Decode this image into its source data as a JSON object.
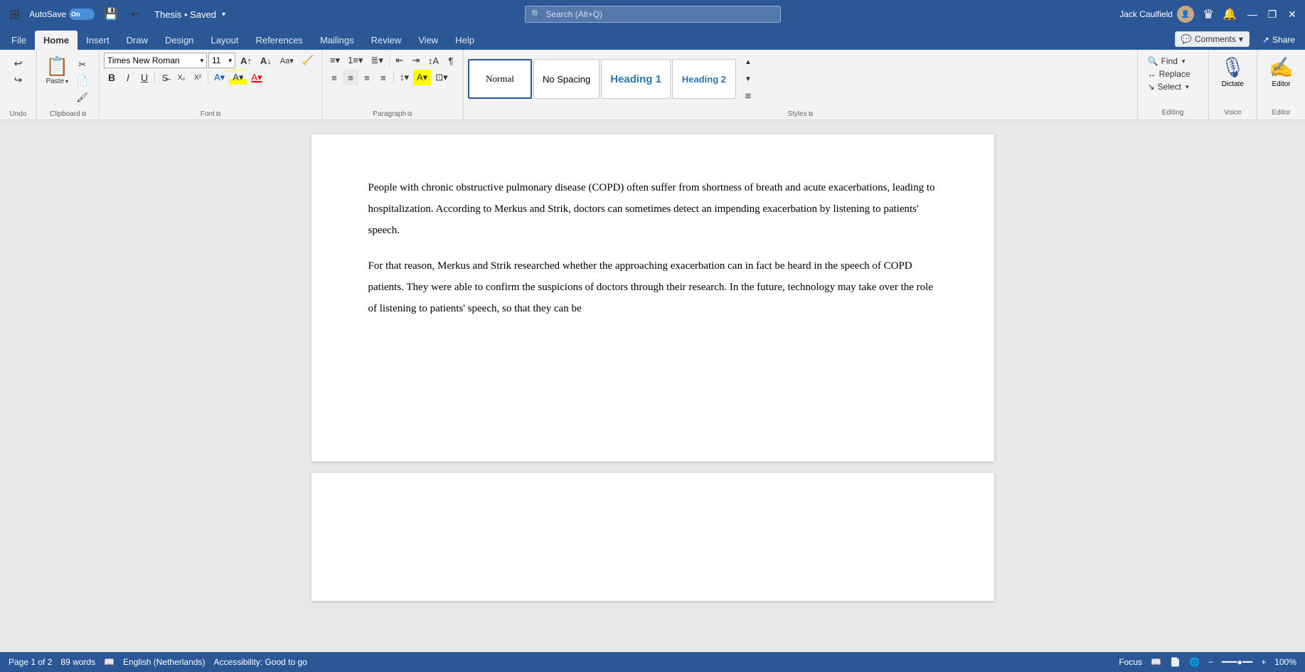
{
  "titleBar": {
    "autosave_label": "AutoSave",
    "autosave_state": "On",
    "save_icon": "💾",
    "doc_title": "Thesis • Saved",
    "search_placeholder": "Search (Alt+Q)",
    "user_name": "Jack Caulfield",
    "minimize_icon": "—",
    "restore_icon": "❐",
    "close_icon": "✕"
  },
  "ribbon": {
    "tabs": [
      {
        "id": "file",
        "label": "File"
      },
      {
        "id": "home",
        "label": "Home",
        "active": true
      },
      {
        "id": "insert",
        "label": "Insert"
      },
      {
        "id": "draw",
        "label": "Draw"
      },
      {
        "id": "design",
        "label": "Design"
      },
      {
        "id": "layout",
        "label": "Layout"
      },
      {
        "id": "references",
        "label": "References"
      },
      {
        "id": "mailings",
        "label": "Mailings"
      },
      {
        "id": "review",
        "label": "Review"
      },
      {
        "id": "view",
        "label": "View"
      },
      {
        "id": "help",
        "label": "Help"
      }
    ],
    "groups": {
      "undo": {
        "label": "Undo"
      },
      "clipboard": {
        "label": "Clipboard",
        "paste_label": "Paste"
      },
      "font": {
        "label": "Font",
        "font_name": "Times New Roman",
        "font_size": "11",
        "bold": "B",
        "italic": "I",
        "underline": "U"
      },
      "paragraph": {
        "label": "Paragraph"
      },
      "styles": {
        "label": "Styles",
        "items": [
          {
            "id": "normal",
            "label": "Normal",
            "active": true
          },
          {
            "id": "no-spacing",
            "label": "No Spacing"
          },
          {
            "id": "heading1",
            "label": "Heading 1"
          },
          {
            "id": "heading2",
            "label": "Heading 2"
          }
        ],
        "select_label": "Select"
      },
      "editing": {
        "label": "Editing",
        "find_label": "Find",
        "replace_label": "Replace",
        "select_label": "Select"
      },
      "voice": {
        "label": "Voice",
        "dictate_label": "Dictate"
      },
      "editor": {
        "label": "Editor",
        "editor_label": "Editor"
      }
    },
    "comments_btn": "Comments",
    "share_btn": "Share"
  },
  "document": {
    "paragraphs": [
      "People with chronic obstructive pulmonary disease (COPD) often suffer from shortness of breath and acute exacerbations, leading to hospitalization. According to Merkus and Strik, doctors can sometimes detect an impending exacerbation by listening to patients' speech.",
      "For that reason, Merkus and Strik researched whether the approaching exacerbation can in fact be heard in the speech of COPD patients. They were able to confirm the suspicions of doctors through their research. In the future, technology may take over the role of listening to patients' speech, so that they can be"
    ]
  },
  "statusBar": {
    "page_info": "Page 1 of 2",
    "word_count": "89 words",
    "language": "English (Netherlands)",
    "accessibility": "Accessibility: Good to go",
    "focus_label": "Focus",
    "zoom_level": "100%"
  }
}
